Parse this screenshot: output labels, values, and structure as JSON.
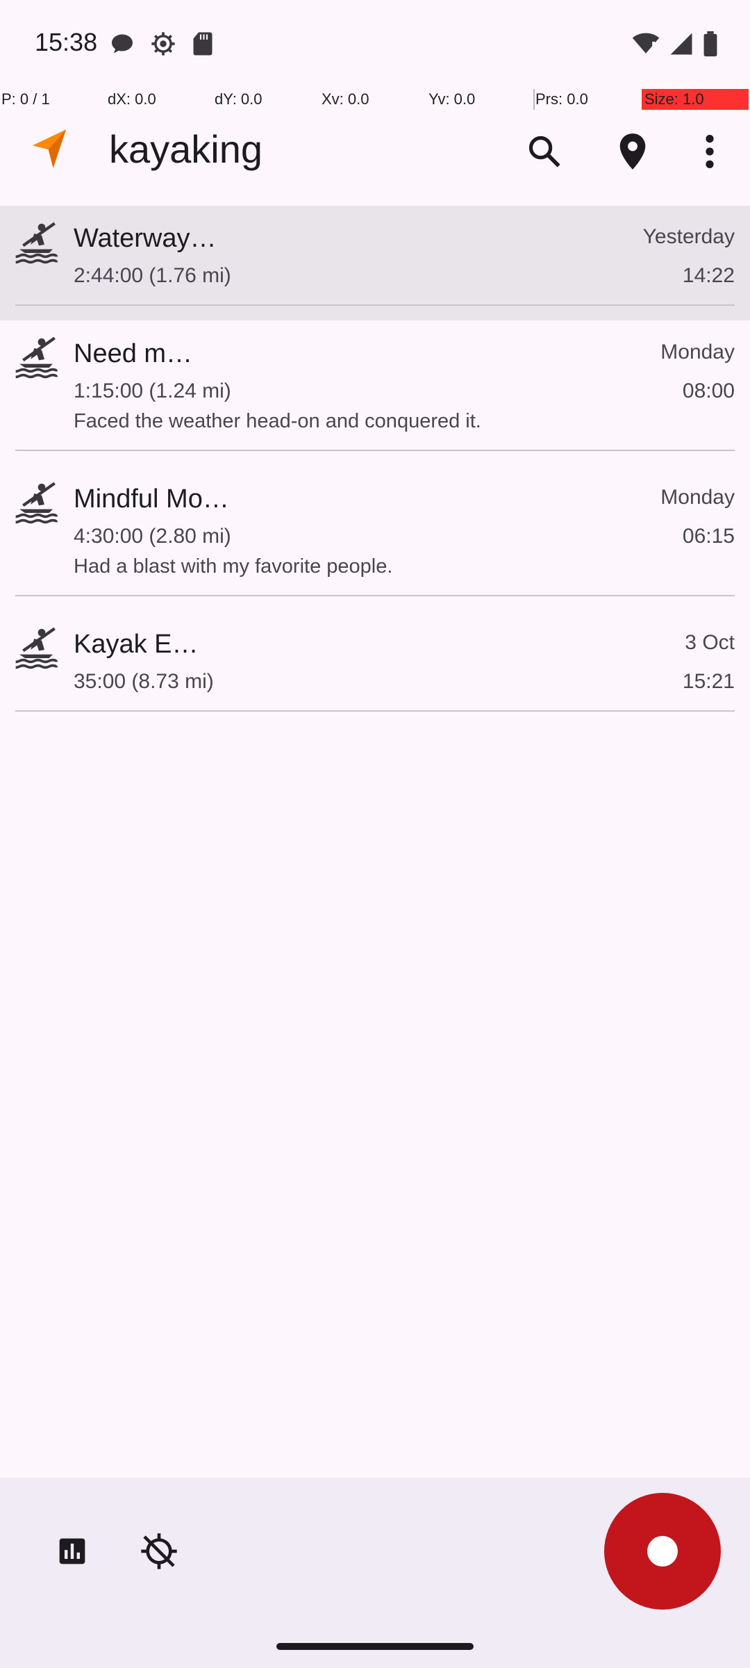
{
  "status_bar": {
    "time": "15:38",
    "icons_left": [
      "chat-bubble-icon",
      "settings-gear-icon",
      "sd-card-icon"
    ],
    "icons_right": [
      "wifi-alert-icon",
      "signal-icon",
      "battery-icon"
    ]
  },
  "debug_bar": {
    "p": "P: 0 / 1",
    "dx": "dX: 0.0",
    "dy": "dY: 0.0",
    "xv": "Xv: 0.0",
    "yv": "Yv: 0.0",
    "prs": "Prs: 0.0",
    "size": "Size: 1.0"
  },
  "app_bar": {
    "title": "kayaking",
    "actions": [
      "search-icon",
      "location-pin-icon",
      "more-vert-icon"
    ]
  },
  "colors": {
    "accent": "#FF8A00",
    "record": "#C2161C",
    "selected_row": "#E8E4EA",
    "background": "#FDF7FD"
  },
  "tracks": [
    {
      "title": "Waterway…",
      "date": "Yesterday",
      "meta": "2:44:00 (1.76 mi)",
      "time": "14:22",
      "description": ""
    },
    {
      "title": "Need m…",
      "date": "Monday",
      "meta": "1:15:00 (1.24 mi)",
      "time": "08:00",
      "description": "Faced the weather head-on and conquered it."
    },
    {
      "title": "Mindful Mo…",
      "date": "Monday",
      "meta": "4:30:00 (2.80 mi)",
      "time": "06:15",
      "description": "Had a blast with my favorite people."
    },
    {
      "title": "Kayak E…",
      "date": "3 Oct",
      "meta": "35:00 (8.73 mi)",
      "time": "15:21",
      "description": ""
    }
  ],
  "bottom_bar": {
    "icons": [
      "bar-chart-icon",
      "gps-off-icon"
    ],
    "fab": "record-icon"
  }
}
